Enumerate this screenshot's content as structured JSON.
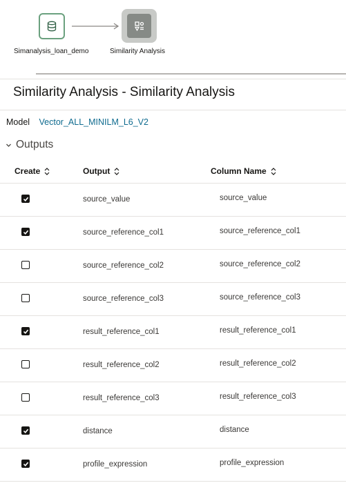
{
  "flow": {
    "nodes": [
      {
        "label": "Simanalysis_loan_demo",
        "icon": "database-icon"
      },
      {
        "label": "Similarity Analysis",
        "icon": "similarity-icon"
      }
    ]
  },
  "panel": {
    "title": "Similarity Analysis - Similarity Analysis",
    "model_label": "Model",
    "model_value": "Vector_ALL_MINILM_L6_V2",
    "section_title": "Outputs"
  },
  "table": {
    "headers": {
      "create": "Create",
      "output": "Output",
      "column_name": "Column Name"
    },
    "rows": [
      {
        "checked": true,
        "output": "source_value",
        "column": "source_value"
      },
      {
        "checked": true,
        "output": "source_reference_col1",
        "column": "source_reference_col1"
      },
      {
        "checked": false,
        "output": "source_reference_col2",
        "column": "source_reference_col2"
      },
      {
        "checked": false,
        "output": "source_reference_col3",
        "column": "source_reference_col3"
      },
      {
        "checked": true,
        "output": "result_reference_col1",
        "column": "result_reference_col1"
      },
      {
        "checked": false,
        "output": "result_reference_col2",
        "column": "result_reference_col2"
      },
      {
        "checked": false,
        "output": "result_reference_col3",
        "column": "result_reference_col3"
      },
      {
        "checked": true,
        "output": "distance",
        "column": "distance"
      },
      {
        "checked": true,
        "output": "profile_expression",
        "column": "profile_expression"
      }
    ]
  },
  "colors": {
    "source_node_border": "#6aa07e",
    "selected_node_bg": "#c8cac7",
    "link": "#0f6b8f"
  }
}
